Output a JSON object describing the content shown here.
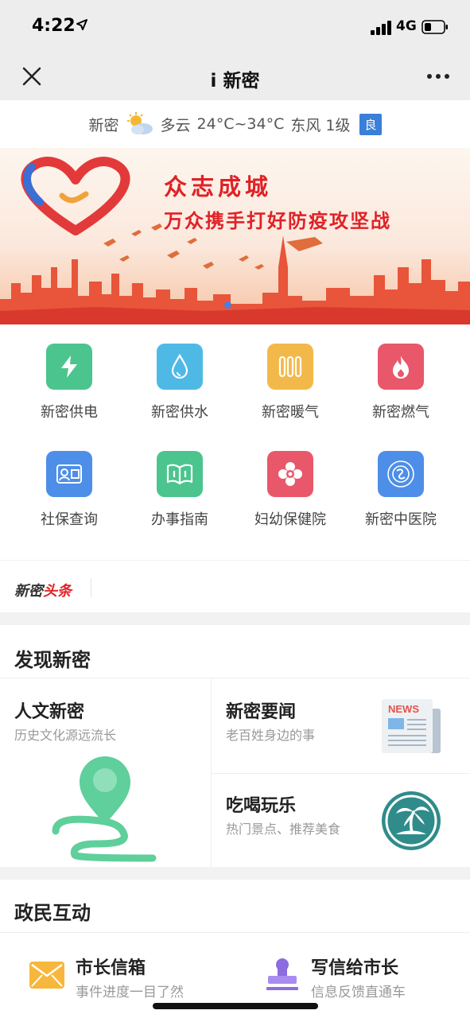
{
  "status_bar": {
    "time": "4:22",
    "network": "4G"
  },
  "nav": {
    "title": "i 新密"
  },
  "weather": {
    "city": "新密",
    "condition": "多云",
    "temp": "24°C~34°C",
    "wind": "东风 1级",
    "air_quality": "良"
  },
  "banner": {
    "headline": "众志成城",
    "subhead": "万众携手打好防疫攻坚战"
  },
  "services": [
    {
      "label": "新密供电",
      "icon": "lightning-icon",
      "color": "#4cc48e"
    },
    {
      "label": "新密供水",
      "icon": "water-drop-icon",
      "color": "#4fb9e6"
    },
    {
      "label": "新密暖气",
      "icon": "radiator-icon",
      "color": "#f2b94a"
    },
    {
      "label": "新密燃气",
      "icon": "flame-icon",
      "color": "#e8576a"
    },
    {
      "label": "社保查询",
      "icon": "social-security-card-icon",
      "color": "#4d8ee8"
    },
    {
      "label": "办事指南",
      "icon": "open-book-icon",
      "color": "#4cc48e"
    },
    {
      "label": "妇幼保健院",
      "icon": "flower-icon",
      "color": "#e8576a"
    },
    {
      "label": "新密中医院",
      "icon": "hospital-emblem-icon",
      "color": "#4d8ee8"
    }
  ],
  "headline_bar": {
    "label_a": "新密",
    "label_b": "头条"
  },
  "discover": {
    "title": "发现新密",
    "culture": {
      "title": "人文新密",
      "subtitle": "历史文化源远流长"
    },
    "news": {
      "title": "新密要闻",
      "subtitle": "老百姓身边的事",
      "badge": "NEWS"
    },
    "fun": {
      "title": "吃喝玩乐",
      "subtitle": "热门景点、推荐美食"
    }
  },
  "interaction": {
    "title": "政民互动",
    "mailbox": {
      "title": "市长信箱",
      "subtitle": "事件进度一目了然"
    },
    "letter": {
      "title": "写信给市长",
      "subtitle": "信息反馈直通车"
    }
  }
}
